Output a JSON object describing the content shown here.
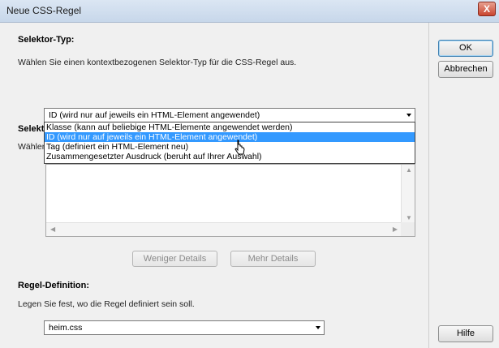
{
  "window": {
    "title": "Neue CSS-Regel",
    "close_label": "X"
  },
  "selector_type": {
    "heading": "Selektor-Typ:",
    "description": "Wählen Sie einen kontextbezogenen Selektor-Typ für die CSS-Regel aus.",
    "selected": "ID (wird nur auf jeweils ein HTML-Element angewendet)",
    "options": [
      "Klasse (kann auf beliebige HTML-Elemente angewendet werden)",
      "ID (wird nur auf jeweils ein HTML-Element angewendet)",
      "Tag (definiert ein HTML-Element neu)",
      "Zusammengesetzter Ausdruck (beruht auf Ihrer Auswahl)"
    ]
  },
  "selector_name": {
    "heading_partial": "Selekt",
    "description_partial": "Wähler"
  },
  "details_buttons": {
    "less": "Weniger Details",
    "more": "Mehr Details"
  },
  "rule_definition": {
    "heading": "Regel-Definition:",
    "description": "Legen Sie fest, wo die Regel definiert sein soll.",
    "selected": "heim.css"
  },
  "side_buttons": {
    "ok": "OK",
    "cancel": "Abbrechen",
    "help": "Hilfe"
  },
  "colors": {
    "selection": "#3399ff",
    "close": "#c9452f",
    "titlebar": "#c7d7ea"
  }
}
